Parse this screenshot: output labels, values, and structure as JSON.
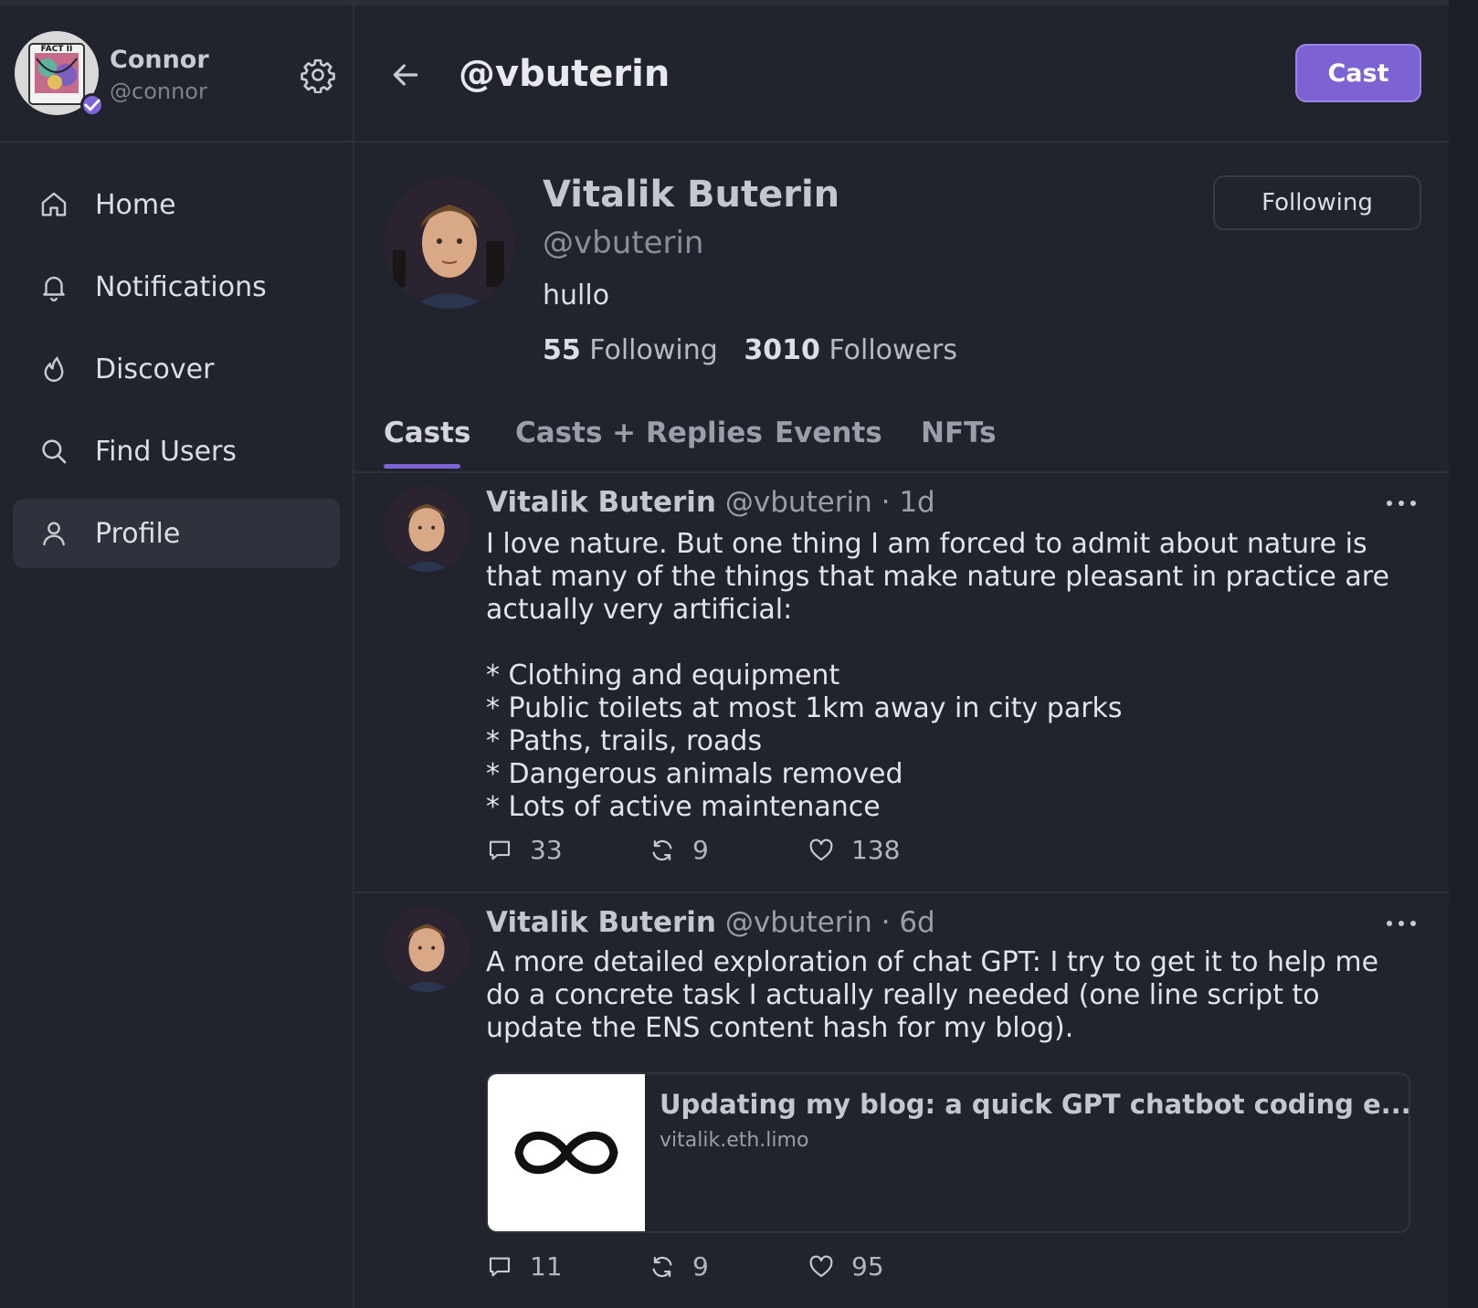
{
  "account": {
    "name": "Connor",
    "handle": "@connor",
    "avatar_text": "FACT II"
  },
  "nav": [
    {
      "label": "Home",
      "icon": "home-icon"
    },
    {
      "label": "Notifications",
      "icon": "bell-icon"
    },
    {
      "label": "Discover",
      "icon": "flame-icon"
    },
    {
      "label": "Find Users",
      "icon": "search-icon"
    },
    {
      "label": "Profile",
      "icon": "user-icon",
      "active": true
    }
  ],
  "header": {
    "title": "@vbuterin",
    "cast_label": "Cast"
  },
  "profile": {
    "name": "Vitalik Buterin",
    "username": "@vbuterin",
    "bio": "hullo",
    "following_button": "Following",
    "following_count": "55",
    "following_label": "Following",
    "followers_count": "3010",
    "followers_label": "Followers"
  },
  "tabs": [
    "Casts",
    "Casts + Replies",
    "Events",
    "NFTs"
  ],
  "posts": [
    {
      "author": "Vitalik Buterin",
      "handle": "@vbuterin",
      "time": "· 1d",
      "text": "I love nature. But one thing I am forced to admit about nature is that many of the things that make nature pleasant in practice are actually very artificial:\n\n* Clothing and equipment\n* Public toilets at most 1km away in city parks\n* Paths, trails, roads\n* Dangerous animals removed\n* Lots of active maintenance",
      "replies": "33",
      "recasts": "9",
      "likes": "138"
    },
    {
      "author": "Vitalik Buterin",
      "handle": "@vbuterin",
      "time": "· 6d",
      "text": "A more detailed exploration of chat GPT: I try to get it to help me do a concrete task I actually really needed (one line script to update the ENS content hash for my blog).",
      "embed_title": "Updating my blog: a quick GPT chatbot coding e...",
      "embed_domain": "vitalik.eth.limo",
      "replies": "11",
      "recasts": "9",
      "likes": "95"
    }
  ],
  "colors": {
    "background": "#21242c",
    "accent": "#7d62d4",
    "border": "#2c3039"
  }
}
